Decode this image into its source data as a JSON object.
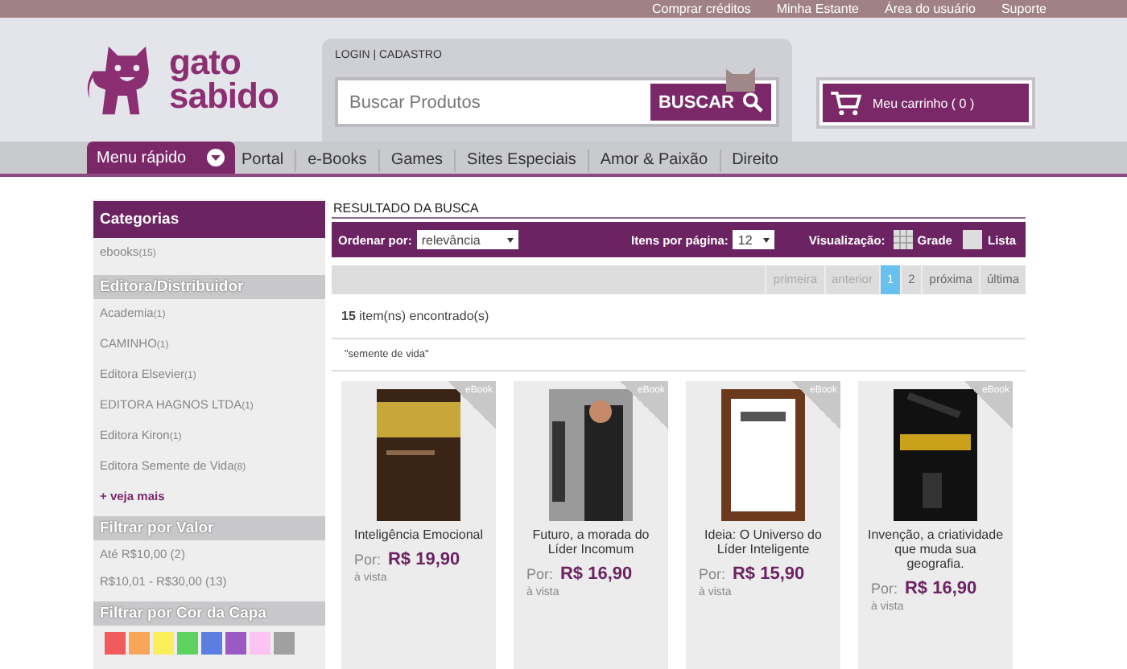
{
  "top_links": [
    "Comprar créditos",
    "Minha Estante",
    "Área do usuário",
    "Suporte"
  ],
  "logo": {
    "line1": "gato",
    "line2": "sabido"
  },
  "account": "LOGIN | CADASTRO",
  "search": {
    "placeholder": "Buscar Produtos",
    "button": "BUSCAR"
  },
  "cart": "Meu carrinho ( 0 )",
  "quick_menu": "Menu rápido",
  "nav": [
    "Portal",
    "e-Books",
    "Games",
    "Sites Especiais",
    "Amor & Paixão",
    "Direito"
  ],
  "sidebar": [
    {
      "kind": "list",
      "title": "Categorias",
      "items": [
        {
          "label": "ebooks",
          "count": "(15)"
        }
      ]
    },
    {
      "kind": "list",
      "title": "Editora/Distribuidor",
      "items": [
        {
          "label": "Academia",
          "count": "(1)"
        },
        {
          "label": "CAMINHO",
          "count": "(1)"
        },
        {
          "label": "Editora Elsevier",
          "count": "(1)"
        },
        {
          "label": "EDITORA HAGNOS LTDA",
          "count": "(1)"
        },
        {
          "label": "Editora Kiron",
          "count": "(1)"
        },
        {
          "label": "Editora Semente de Vida",
          "count": "(8)"
        }
      ],
      "more": "+ veja mais"
    },
    {
      "kind": "list",
      "title": "Filtrar por Valor",
      "items": [
        {
          "label": "Até R$10,00 (2)"
        },
        {
          "label": "R$10,01 - R$30,00 (13)"
        }
      ]
    },
    {
      "kind": "swatches",
      "title": "Filtrar por Cor da Capa",
      "swatches": [
        {
          "color": "#f25b5b"
        },
        {
          "color": "#f9a55a"
        },
        {
          "color": "#faee5a"
        },
        {
          "color": "#5dd25e"
        },
        {
          "color": "#5a7fe0"
        },
        {
          "color": "#9b59c4"
        },
        {
          "color": "#fcc3f3"
        },
        {
          "color": "#a0a0a0"
        }
      ]
    }
  ],
  "results": {
    "title": "RESULTADO DA BUSCA",
    "sort": {
      "label": "Ordenar por:",
      "value": "relevância"
    },
    "per_page": {
      "label": "Itens por página:",
      "value": "12"
    },
    "view": {
      "label": "Visualização:",
      "options": [
        "Grade",
        "Lista"
      ]
    },
    "pagination": [
      {
        "label": "primeira",
        "selected": false,
        "disabled": true
      },
      {
        "label": "anterior",
        "selected": false,
        "disabled": true
      },
      {
        "label": "1",
        "selected": true,
        "disabled": false
      },
      {
        "label": "2",
        "selected": false,
        "disabled": false
      },
      {
        "label": "próxima",
        "selected": false,
        "disabled": false
      },
      {
        "label": "última",
        "selected": false,
        "disabled": false
      }
    ],
    "count": "15",
    "count_text": "item(ns) encontrado(s)",
    "query": "\"semente de vida\"",
    "products": [
      {
        "badge": "eBook",
        "title": "Inteligência Emocional",
        "price_label": "Por:",
        "price": "R$ 19,90",
        "terms": "à vista"
      },
      {
        "badge": "eBook",
        "title": "Futuro, a morada do Líder Incomum",
        "price_label": "Por:",
        "price": "R$ 16,90",
        "terms": "à vista"
      },
      {
        "badge": "eBook",
        "title": "Ideia: O Universo do Líder Inteligente",
        "price_label": "Por:",
        "price": "R$ 15,90",
        "terms": "à vista"
      },
      {
        "badge": "eBook",
        "title": "Invenção, a criatividade que muda sua geografia.",
        "price_label": "Por:",
        "price": "R$ 16,90",
        "terms": "à vista"
      }
    ]
  }
}
